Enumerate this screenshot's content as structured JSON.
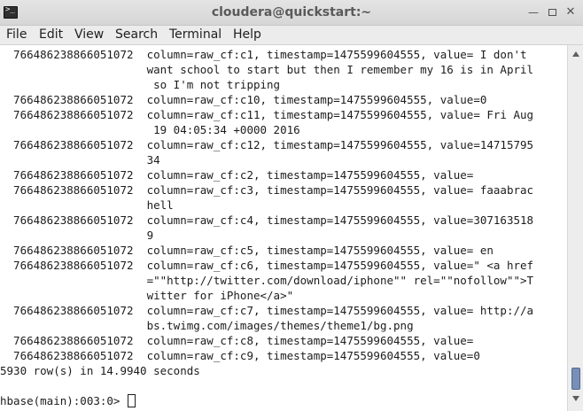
{
  "window": {
    "title": "cloudera@quickstart:~",
    "min_symbol": "—",
    "close_symbol": "✕"
  },
  "menu": [
    {
      "label": "File"
    },
    {
      "label": "Edit"
    },
    {
      "label": "View"
    },
    {
      "label": "Search"
    },
    {
      "label": "Terminal"
    },
    {
      "label": "Help"
    }
  ],
  "terminal": {
    "lines": [
      "  766486238866051072  column=raw_cf:c1, timestamp=1475599604555, value= I don't",
      "                      want school to start but then I remember my 16 is in April",
      "                       so I'm not tripping",
      "  766486238866051072  column=raw_cf:c10, timestamp=1475599604555, value=0",
      "  766486238866051072  column=raw_cf:c11, timestamp=1475599604555, value= Fri Aug",
      "                       19 04:05:34 +0000 2016",
      "  766486238866051072  column=raw_cf:c12, timestamp=1475599604555, value=14715795",
      "                      34",
      "  766486238866051072  column=raw_cf:c2, timestamp=1475599604555, value=",
      "  766486238866051072  column=raw_cf:c3, timestamp=1475599604555, value= faaabrac",
      "                      hell",
      "  766486238866051072  column=raw_cf:c4, timestamp=1475599604555, value=307163518",
      "                      9",
      "  766486238866051072  column=raw_cf:c5, timestamp=1475599604555, value= en",
      "  766486238866051072  column=raw_cf:c6, timestamp=1475599604555, value=\" <a href",
      "                      =\"\"http://twitter.com/download/iphone\"\" rel=\"\"nofollow\"\">T",
      "                      witter for iPhone</a>\"",
      "  766486238866051072  column=raw_cf:c7, timestamp=1475599604555, value= http://a",
      "                      bs.twimg.com/images/themes/theme1/bg.png",
      "  766486238866051072  column=raw_cf:c8, timestamp=1475599604555, value=",
      "  766486238866051072  column=raw_cf:c9, timestamp=1475599604555, value=0",
      "5930 row(s) in 14.9940 seconds",
      ""
    ],
    "prompt": "hbase(main):003:0> "
  }
}
